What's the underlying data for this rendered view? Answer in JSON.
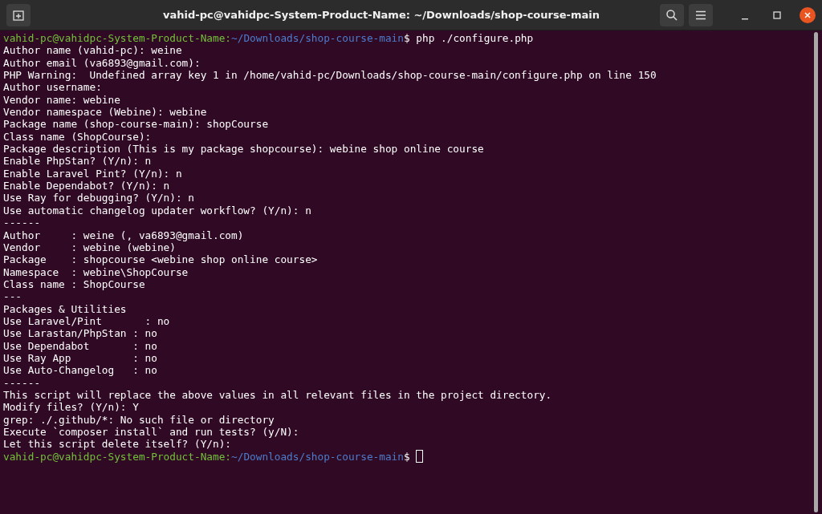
{
  "window": {
    "title": "vahid-pc@vahidpc-System-Product-Name: ~/Downloads/shop-course-main"
  },
  "terminal": {
    "lines": [
      {
        "kind": "prompt",
        "user": "vahid-pc@vahidpc-System-Product-Name:",
        "path": "~/Downloads/shop-course-main",
        "symbol": "$",
        "command": "php ./configure.php",
        "cursor": false
      },
      {
        "kind": "output",
        "text": "Author name (vahid-pc): weine"
      },
      {
        "kind": "output",
        "text": "Author email (va6893@gmail.com):"
      },
      {
        "kind": "output",
        "text": "PHP Warning:  Undefined array key 1 in /home/vahid-pc/Downloads/shop-course-main/configure.php on line 150"
      },
      {
        "kind": "output",
        "text": "Author username:"
      },
      {
        "kind": "output",
        "text": "Vendor name: webine"
      },
      {
        "kind": "output",
        "text": "Vendor namespace (Webine): webine"
      },
      {
        "kind": "output",
        "text": "Package name (shop-course-main): shopCourse"
      },
      {
        "kind": "output",
        "text": "Class name (ShopCourse):"
      },
      {
        "kind": "output",
        "text": "Package description (This is my package shopcourse): webine shop online course"
      },
      {
        "kind": "output",
        "text": "Enable PhpStan? (Y/n): n"
      },
      {
        "kind": "output",
        "text": "Enable Laravel Pint? (Y/n): n"
      },
      {
        "kind": "output",
        "text": "Enable Dependabot? (Y/n): n"
      },
      {
        "kind": "output",
        "text": "Use Ray for debugging? (Y/n): n"
      },
      {
        "kind": "output",
        "text": "Use automatic changelog updater workflow? (Y/n): n"
      },
      {
        "kind": "output",
        "text": "------"
      },
      {
        "kind": "output",
        "text": "Author     : weine (, va6893@gmail.com)"
      },
      {
        "kind": "output",
        "text": "Vendor     : webine (webine)"
      },
      {
        "kind": "output",
        "text": "Package    : shopcourse <webine shop online course>"
      },
      {
        "kind": "output",
        "text": "Namespace  : webine\\ShopCourse"
      },
      {
        "kind": "output",
        "text": "Class name : ShopCourse"
      },
      {
        "kind": "output",
        "text": "---"
      },
      {
        "kind": "output",
        "text": "Packages & Utilities"
      },
      {
        "kind": "output",
        "text": "Use Laravel/Pint       : no"
      },
      {
        "kind": "output",
        "text": "Use Larastan/PhpStan : no"
      },
      {
        "kind": "output",
        "text": "Use Dependabot       : no"
      },
      {
        "kind": "output",
        "text": "Use Ray App          : no"
      },
      {
        "kind": "output",
        "text": "Use Auto-Changelog   : no"
      },
      {
        "kind": "output",
        "text": "------"
      },
      {
        "kind": "output",
        "text": "This script will replace the above values in all relevant files in the project directory."
      },
      {
        "kind": "output",
        "text": "Modify files? (Y/n): Y"
      },
      {
        "kind": "output",
        "text": "grep: ./.github/*: No such file or directory"
      },
      {
        "kind": "output",
        "text": "Execute `composer install` and run tests? (y/N):"
      },
      {
        "kind": "output",
        "text": "Let this script delete itself? (Y/n):"
      },
      {
        "kind": "prompt",
        "user": "vahid-pc@vahidpc-System-Product-Name:",
        "path": "~/Downloads/shop-course-main",
        "symbol": "$",
        "cursor": true
      }
    ]
  }
}
